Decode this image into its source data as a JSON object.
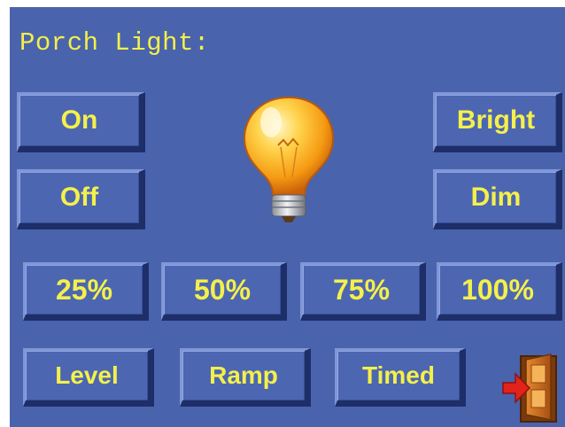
{
  "header": {
    "title": "Porch Light:"
  },
  "controls": {
    "on": "On",
    "off": "Off",
    "bright": "Bright",
    "dim": "Dim"
  },
  "presets": [
    "25%",
    "50%",
    "75%",
    "100%"
  ],
  "modes": [
    "Level",
    "Ramp",
    "Timed"
  ],
  "icons": {
    "bulb": "light-bulb-icon",
    "exit": "exit-door-icon"
  },
  "colors": {
    "background": "#4a63ad",
    "label": "#f4f04a"
  }
}
